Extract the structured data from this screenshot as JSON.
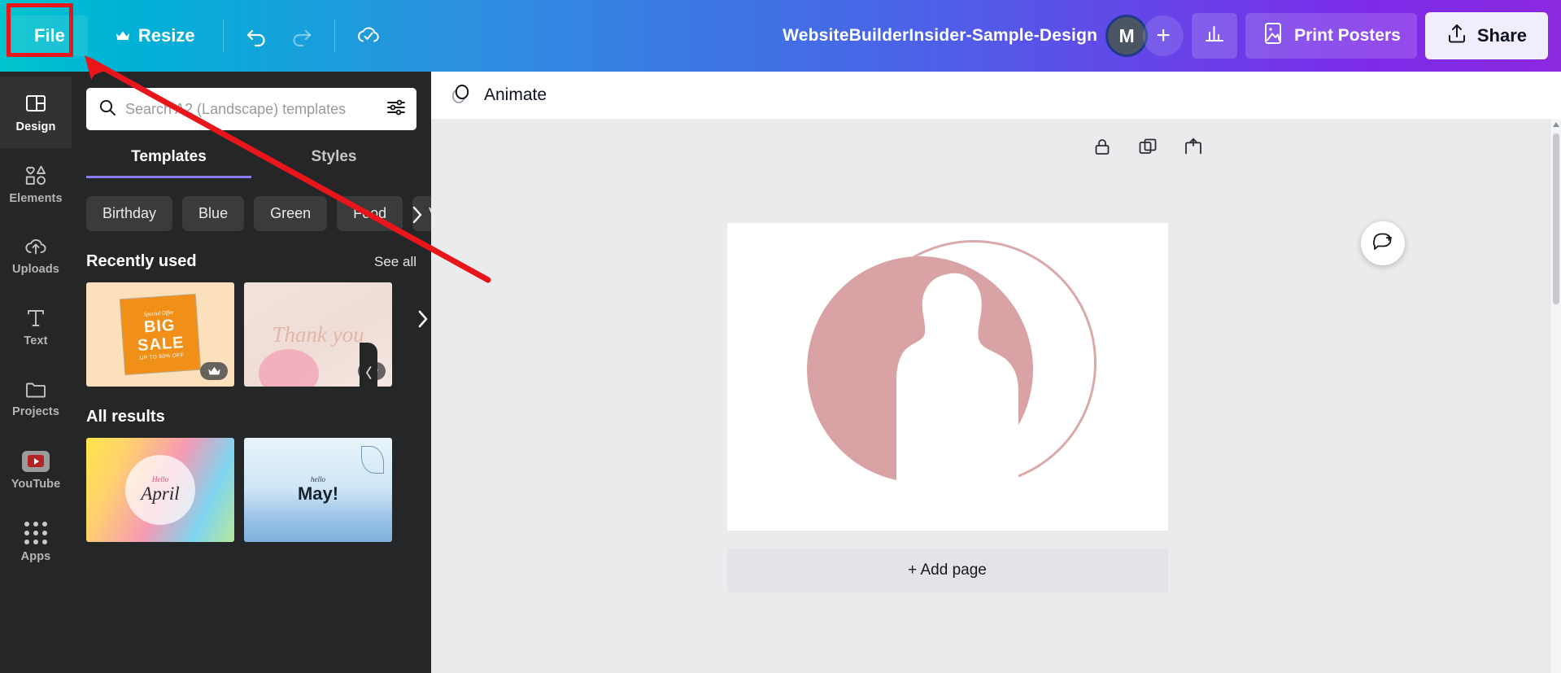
{
  "topbar": {
    "file_label": "File",
    "resize_label": "Resize",
    "crown_icon": "crown-icon",
    "undo_icon": "undo-arrow-icon",
    "redo_icon": "redo-arrow-icon",
    "cloud_saved_icon": "cloud-check-icon",
    "doc_title": "WebsiteBuilderInsider-Sample-Design",
    "avatar_initial": "M",
    "add_collaborator_label": "+",
    "insights_icon": "bar-chart-icon",
    "print_posters_label": "Print Posters",
    "print_icon": "print-poster-icon",
    "share_label": "Share",
    "share_icon": "share-upload-icon",
    "gradient_start": "#00c4cc",
    "gradient_end": "#8b29e0"
  },
  "rail": {
    "items": [
      {
        "label": "Design",
        "icon": "layout-design-icon",
        "active": true
      },
      {
        "label": "Elements",
        "icon": "shapes-elements-icon",
        "active": false
      },
      {
        "label": "Uploads",
        "icon": "cloud-upload-icon",
        "active": false
      },
      {
        "label": "Text",
        "icon": "text-t-icon",
        "active": false
      },
      {
        "label": "Projects",
        "icon": "folder-icon",
        "active": false
      },
      {
        "label": "YouTube",
        "icon": "youtube-icon",
        "active": false
      },
      {
        "label": "Apps",
        "icon": "apps-grid-icon",
        "active": false
      }
    ]
  },
  "panel": {
    "search": {
      "placeholder": "Search A2 (Landscape) templates",
      "value": "",
      "search_icon": "search-icon",
      "filter_icon": "filter-sliders-icon"
    },
    "tabs": [
      {
        "label": "Templates",
        "active": true
      },
      {
        "label": "Styles",
        "active": false
      }
    ],
    "active_tab_underline_color": "#8b7bf0",
    "chips": [
      "Birthday",
      "Blue",
      "Green",
      "Food",
      "Vintage"
    ],
    "chips_next_icon": "chevron-right-icon",
    "recently_used": {
      "title": "Recently used",
      "see_all_label": "See all",
      "next_icon": "chevron-right-icon",
      "items": [
        {
          "name": "big-sale-template",
          "special_offer": "Special Offer",
          "headline": "BIG SALE",
          "subline": "UP TO 50% OFF",
          "premium": true,
          "premium_icon": "crown-icon"
        },
        {
          "name": "thank-you-template",
          "headline": "Thank you",
          "premium": true,
          "premium_icon": "crown-icon"
        }
      ]
    },
    "all_results": {
      "title": "All results",
      "items": [
        {
          "name": "hello-april-template",
          "hello": "Hello",
          "headline": "April"
        },
        {
          "name": "hello-may-template",
          "hello": "hello",
          "headline": "May!"
        }
      ]
    },
    "collapse_icon": "chevron-left-icon"
  },
  "editor": {
    "animate_label": "Animate",
    "animate_icon": "animate-circles-icon",
    "page_tools": [
      {
        "name": "lock-page-icon"
      },
      {
        "name": "duplicate-page-icon"
      },
      {
        "name": "add-page-icon"
      }
    ],
    "add_page_label": "+ Add page",
    "comment_icon": "add-comment-icon",
    "canvas_background": "#eaebed",
    "page_background": "#ffffff",
    "artwork": {
      "name": "woman-silhouette-portrait",
      "disc_color": "#d9a3a5",
      "ring_color": "#dba9aa",
      "silhouette_color": "#ffffff"
    },
    "scrollbar": {
      "up_icon": "caret-up-icon",
      "down_icon": "caret-down-icon"
    }
  },
  "annotation": {
    "highlight_target": "file-button",
    "highlight_color": "#e8151b",
    "arrow": "red-arrow-pointing-to-file-button"
  }
}
